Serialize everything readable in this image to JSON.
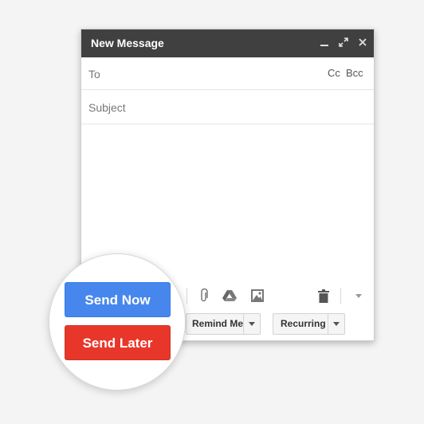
{
  "compose": {
    "title": "New Message",
    "to_label": "To",
    "cc_label": "Cc",
    "bcc_label": "Bcc",
    "subject_placeholder": "Subject"
  },
  "toolbar": {
    "remind_label": "Remind Me",
    "recurring_label": "Recurring"
  },
  "actions": {
    "send_now_label": "Send Now",
    "send_later_label": "Send Later"
  },
  "icons": [
    "minimize-icon",
    "expand-icon",
    "close-icon",
    "attachment-icon",
    "drive-icon",
    "image-icon",
    "trash-icon",
    "more-options-icon"
  ],
  "colors": {
    "titlebar": "#404040",
    "send_now": "#4787ed",
    "send_later": "#e8372a"
  }
}
